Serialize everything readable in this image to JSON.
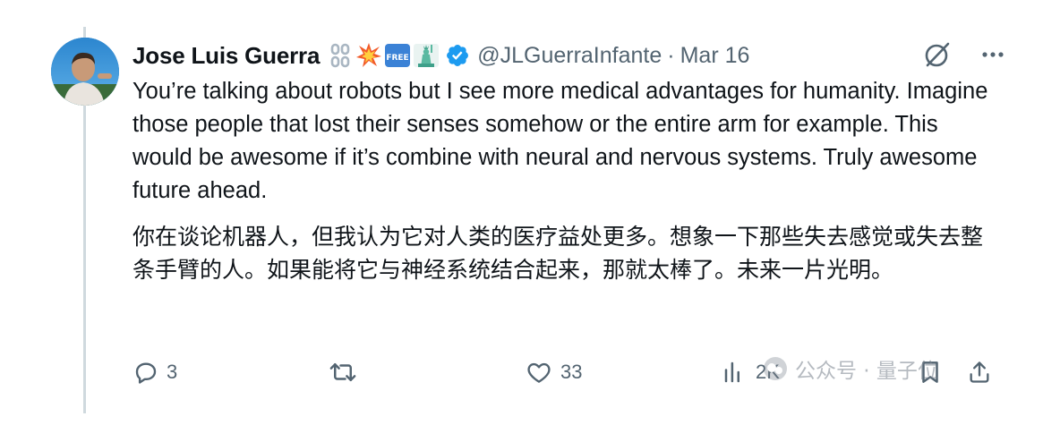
{
  "tweet": {
    "author": {
      "display_name": "Jose Luis Guerra",
      "handle": "@JLGuerraInfante",
      "separator": "·",
      "date": "Mar 16",
      "badges": [
        "chain-icon",
        "collision-icon",
        "free-button-icon",
        "statue-of-liberty-icon"
      ],
      "verified": true
    },
    "text_en": "You’re talking about robots but I see more medical advantages for humanity. Imagine those people that lost their senses somehow or the entire arm for example. This would be awesome if it’s combine with neural and nervous systems. Truly awesome future ahead.",
    "text_zh": "你在谈论机器人，但我认为它对人类的医疗益处更多。想象一下那些失去感觉或失去整条手臂的人。如果能将它与神经系统结合起来，那就太棒了。未来一片光明。",
    "actions": {
      "replies": "3",
      "retweets": "",
      "likes": "33",
      "views": "2K"
    }
  },
  "watermark": {
    "text": "公众号 · 量子位"
  },
  "colors": {
    "text": "#0f1419",
    "secondary": "#536471",
    "verified": "#1d9bf0",
    "thread_line": "#cfd9de"
  }
}
